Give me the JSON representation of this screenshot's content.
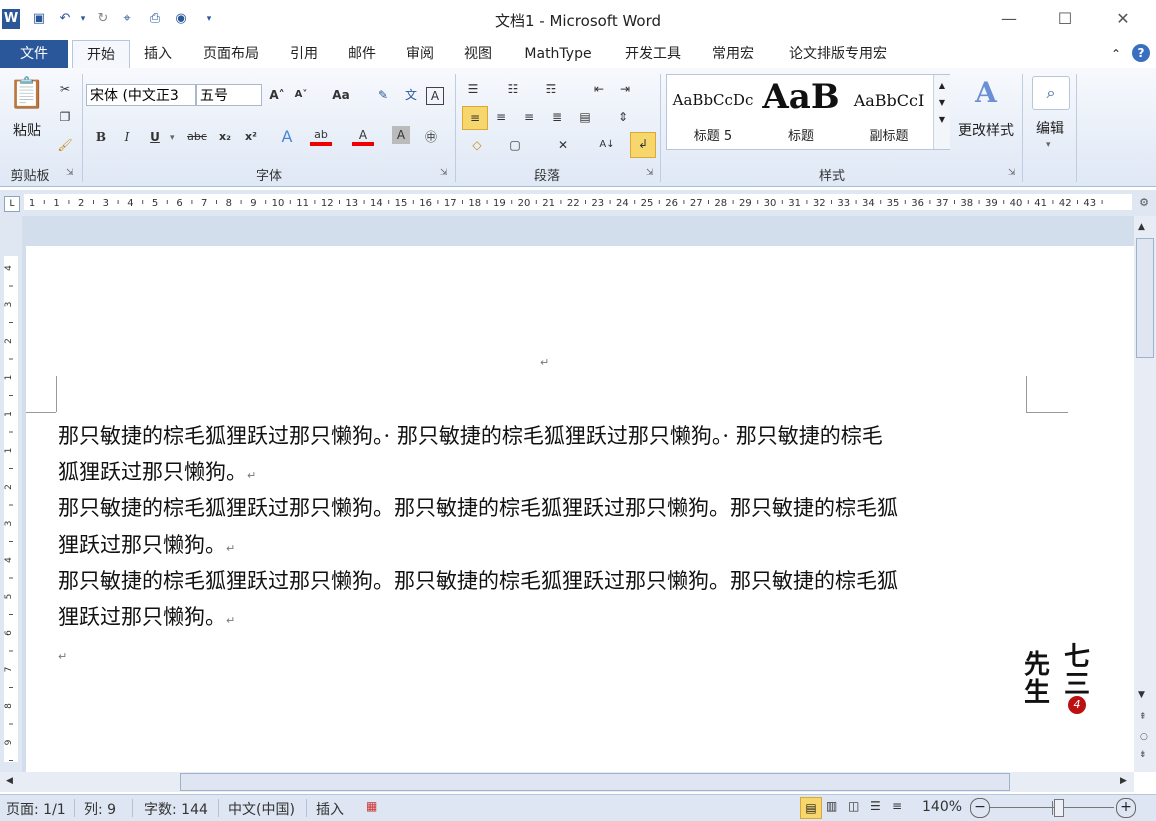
{
  "window": {
    "title": "文档1 - Microsoft Word",
    "minimize": "—",
    "maximize": "☐",
    "close": "✕"
  },
  "qat": [
    "save-icon",
    "undo-icon",
    "redo-icon"
  ],
  "tabs": [
    "文件",
    "开始",
    "插入",
    "页面布局",
    "引用",
    "邮件",
    "审阅",
    "视图",
    "MathType",
    "开发工具",
    "常用宏",
    "论文排版专用宏"
  ],
  "ribbon": {
    "clipboard": {
      "paste_label": "粘贴",
      "group_label": "剪贴板"
    },
    "font": {
      "font_name": "宋体 (中文正3",
      "font_size": "五号",
      "group_label": "字体",
      "bold": "B",
      "italic": "I",
      "underline": "U",
      "strike": "abc",
      "sub": "x₂",
      "sup": "x²",
      "grow": "A˄",
      "shrink": "A˅",
      "case": "Aa"
    },
    "paragraph": {
      "group_label": "段落"
    },
    "styles": {
      "group_label": "样式",
      "items": [
        {
          "sample": "AaBbCcDc",
          "name": "标题 5"
        },
        {
          "sample": "AaB",
          "name": "标题"
        },
        {
          "sample": "AaBbCcI",
          "name": "副标题"
        }
      ],
      "change_styles": "更改样式"
    },
    "editing": {
      "label": "编辑"
    }
  },
  "ruler": {
    "numbers": [
      "1",
      "1",
      "2",
      "3",
      "4",
      "5",
      "6",
      "7",
      "8",
      "9",
      "10",
      "11",
      "12",
      "13",
      "14",
      "15",
      "16",
      "17",
      "18",
      "19",
      "20",
      "21",
      "22",
      "23",
      "24",
      "25",
      "26",
      "27",
      "28",
      "29",
      "30",
      "31",
      "32",
      "33",
      "34",
      "35",
      "36",
      "37",
      "38",
      "39",
      "40",
      "41",
      "42",
      "43"
    ],
    "vnumbers": [
      "4",
      "3",
      "2",
      "1",
      "1",
      "1",
      "2",
      "3",
      "4",
      "5",
      "6",
      "7",
      "8",
      "9"
    ]
  },
  "document": {
    "header_mark": "↵",
    "lines": [
      "那只敏捷的棕毛狐狸跃过那只懒狗。· 那只敏捷的棕毛狐狸跃过那只懒狗。· 那只敏捷的棕毛",
      "狐狸跃过那只懒狗。",
      "那只敏捷的棕毛狐狸跃过那只懒狗。那只敏捷的棕毛狐狸跃过那只懒狗。那只敏捷的棕毛狐",
      "狸跃过那只懒狗。",
      "那只敏捷的棕毛狐狸跃过那只懒狗。那只敏捷的棕毛狐狸跃过那只懒狗。那只敏捷的棕毛狐",
      "狸跃过那只懒狗。"
    ],
    "para_mark": "↵"
  },
  "watermark": {
    "text": [
      "七",
      "三",
      "先",
      "生"
    ],
    "badge": "4"
  },
  "status": {
    "page": "页面: 1/1",
    "column": "列: 9",
    "words": "字数: 144",
    "language": "中文(中国)",
    "mode": "插入",
    "zoom": "140%"
  },
  "colors": {
    "accent": "#2a579a",
    "highlight": "#f8d66e"
  }
}
